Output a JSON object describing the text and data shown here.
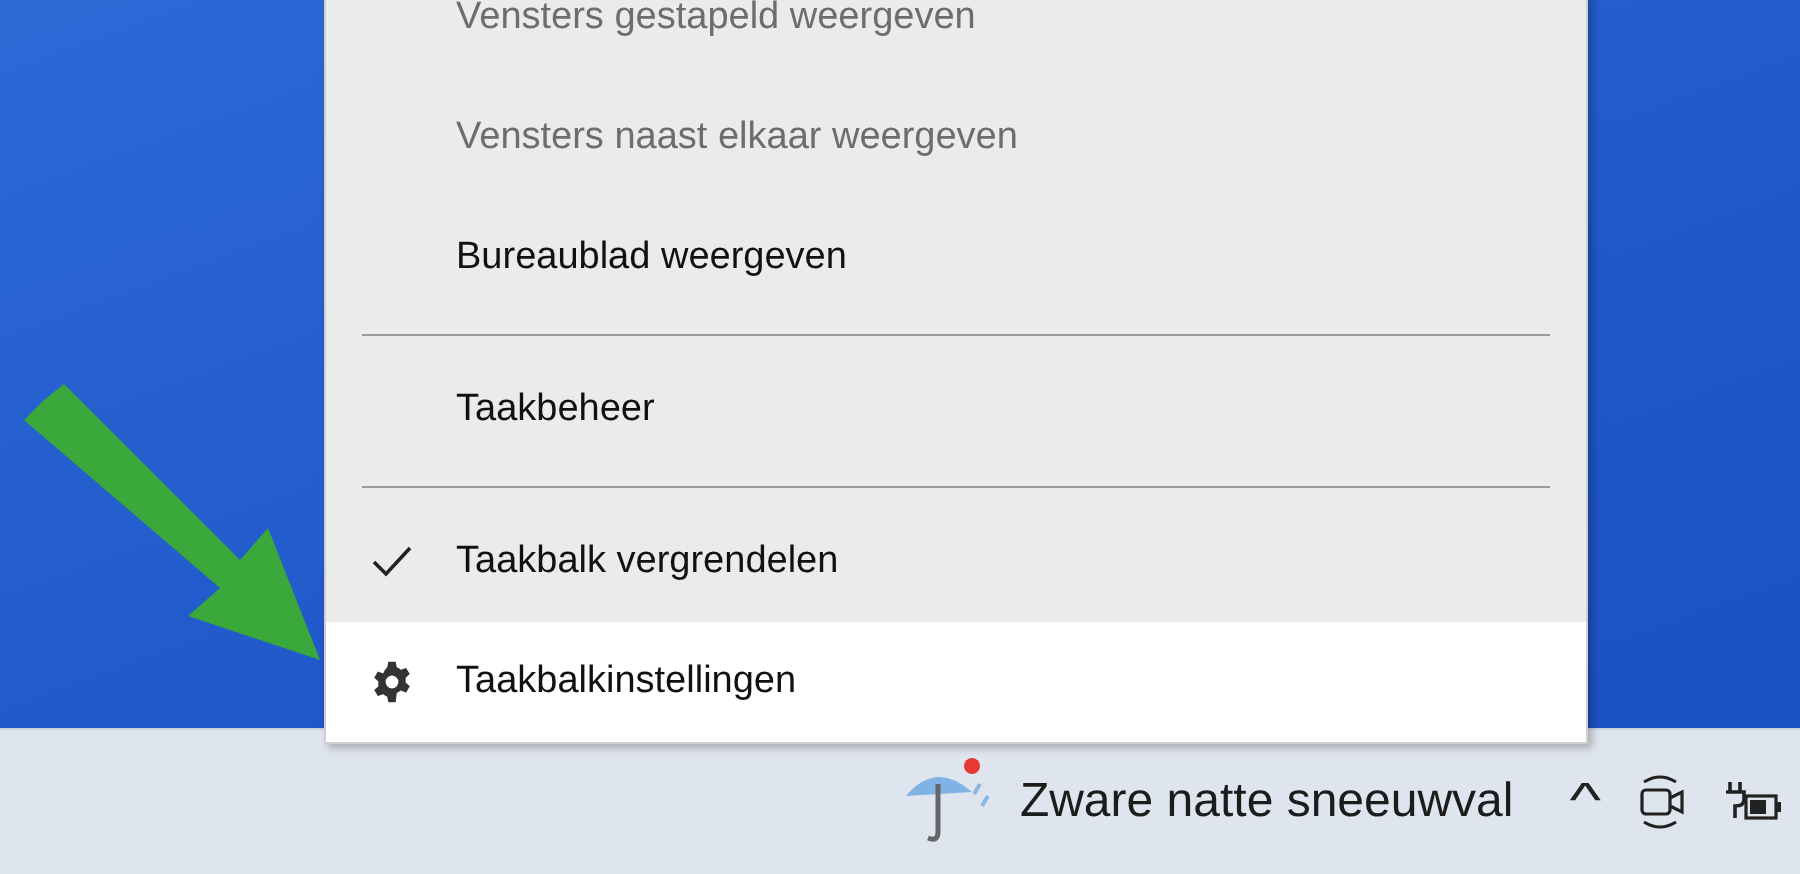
{
  "context_menu": {
    "items": [
      {
        "kind": "item",
        "label": "Vensters gestapeld weergeven",
        "disabled": true,
        "checked": false,
        "selected": false
      },
      {
        "kind": "item",
        "label": "Vensters naast elkaar weergeven",
        "disabled": true,
        "checked": false,
        "selected": false
      },
      {
        "kind": "item",
        "label": "Bureaublad weergeven",
        "disabled": false,
        "checked": false,
        "selected": false
      },
      {
        "kind": "separator"
      },
      {
        "kind": "item",
        "label": "Taakbeheer",
        "disabled": false,
        "checked": false,
        "selected": false
      },
      {
        "kind": "separator"
      },
      {
        "kind": "item",
        "label": "Taakbalk vergrendelen",
        "disabled": false,
        "checked": true,
        "selected": false
      },
      {
        "kind": "settings",
        "label": "Taakbalkinstellingen",
        "disabled": false,
        "checked": false,
        "selected": true
      }
    ]
  },
  "taskbar": {
    "weather": "Zware natte sneeuwval",
    "tray_chevron": "^"
  }
}
